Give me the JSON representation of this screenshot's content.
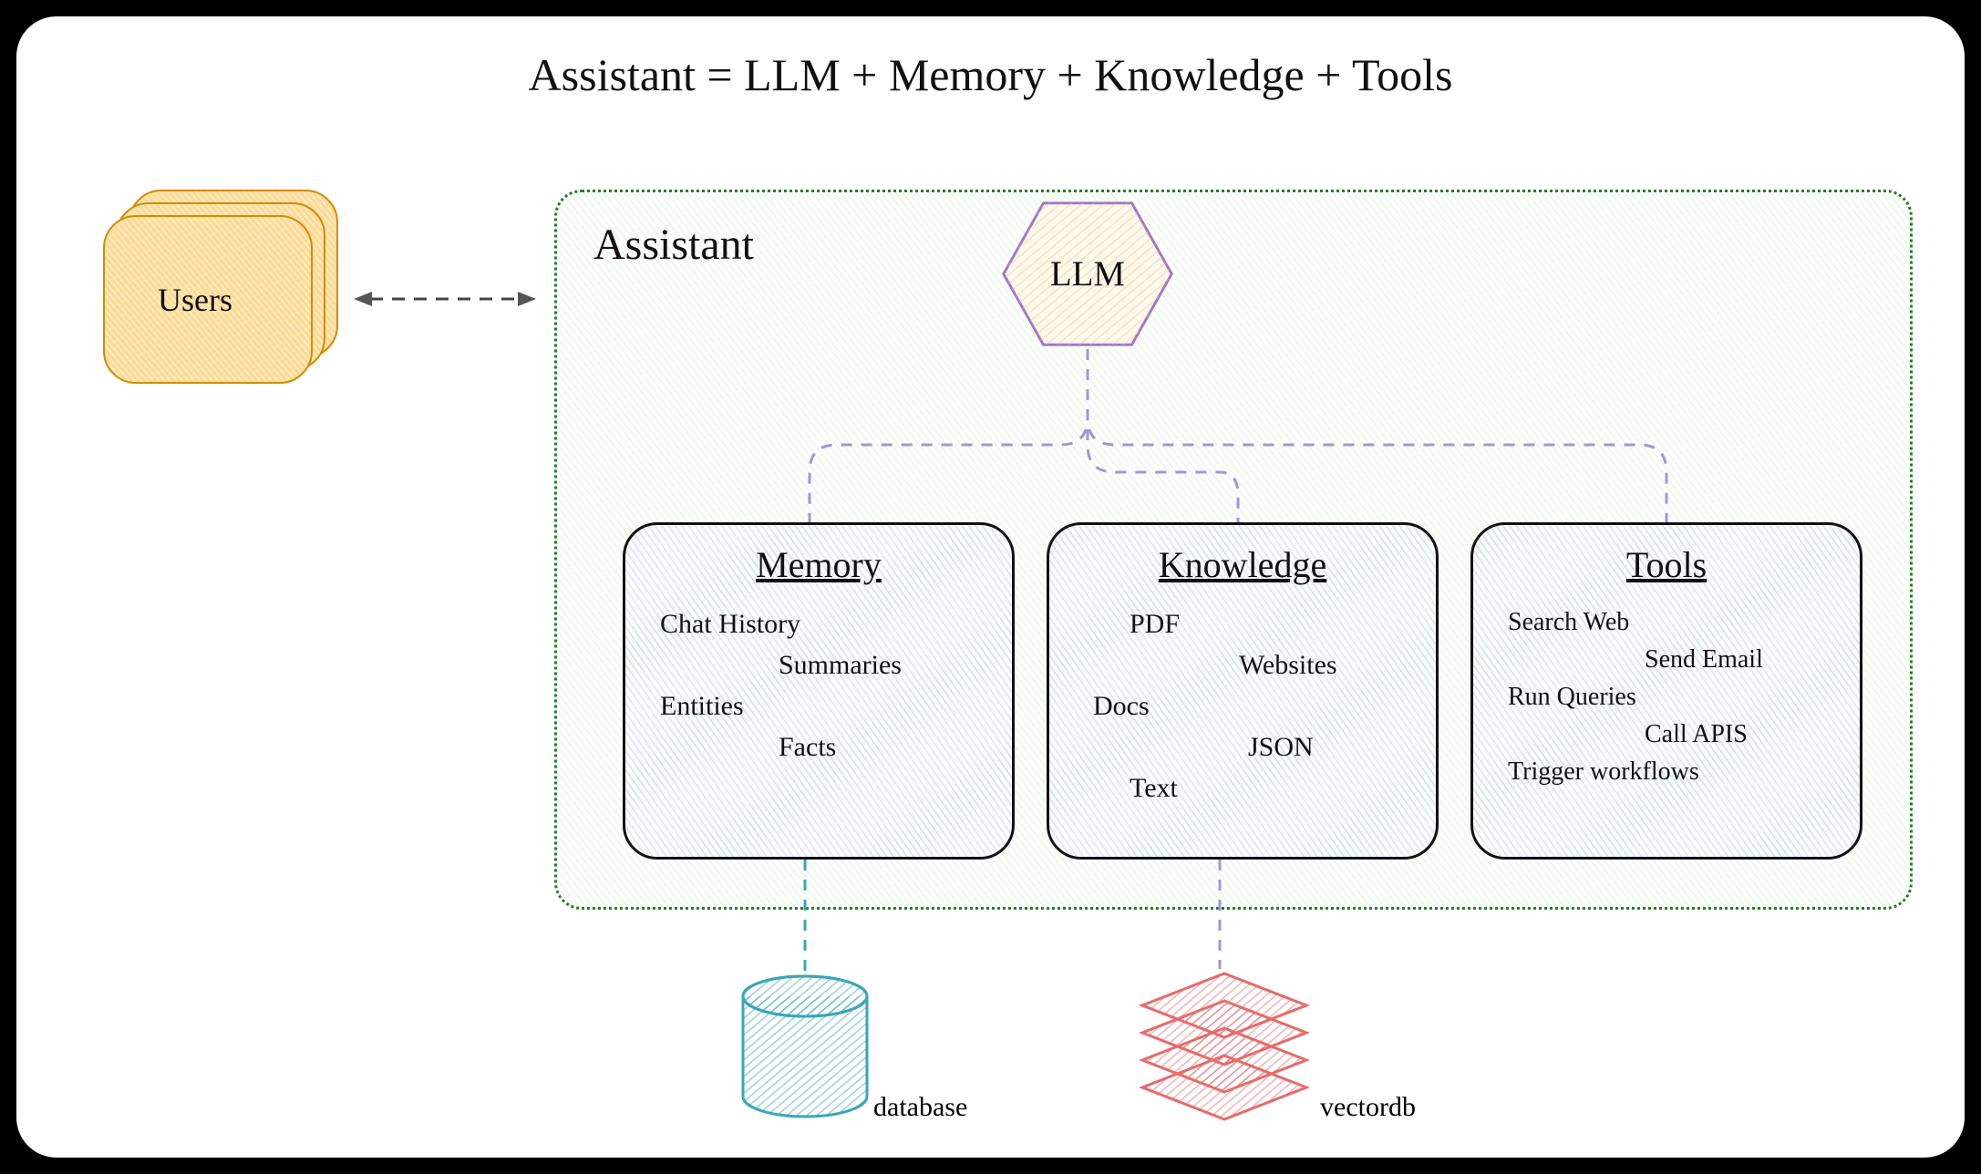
{
  "title": "Assistant = LLM + Memory + Knowledge + Tools",
  "users": {
    "label": "Users"
  },
  "assistant": {
    "label": "Assistant"
  },
  "llm": {
    "label": "LLM"
  },
  "components": {
    "memory": {
      "title": "Memory",
      "items": [
        "Chat History",
        "Summaries",
        "Entities",
        "Facts"
      ]
    },
    "knowledge": {
      "title": "Knowledge",
      "items": [
        "PDF",
        "Websites",
        "Docs",
        "JSON",
        "Text"
      ]
    },
    "tools": {
      "title": "Tools",
      "items": [
        "Search Web",
        "Send Email",
        "Run Queries",
        "Call APIS",
        "Trigger workflows"
      ]
    }
  },
  "storage": {
    "database": "database",
    "vectordb": "vectordb"
  },
  "colors": {
    "users_border": "#d38b00",
    "assistant_border": "#2a7a2a",
    "llm_border": "#a574c9",
    "connector": "#9f96d9",
    "database": "#3aa6b9",
    "vectordb": "#e86a6a"
  }
}
